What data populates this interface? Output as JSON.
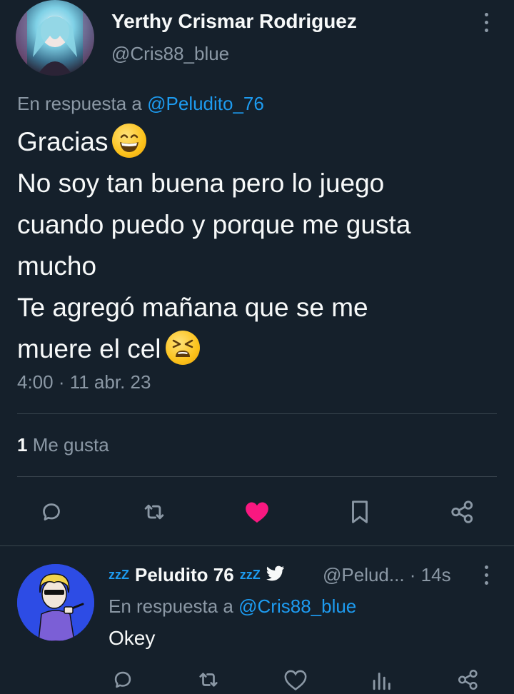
{
  "tweet": {
    "author_name": "Yerthy Crismar Rodriguez",
    "author_handle": "@Cris88_blue",
    "reply_prefix": "En respuesta a",
    "reply_to": "@Peludito_76",
    "lines": [
      "Gracias",
      "No soy tan buena pero lo juego",
      "cuando puedo y porque me gusta",
      "mucho",
      "Te agregó mañana que se me",
      "muere el cel"
    ],
    "emojis": [
      "grinning-face-emoji",
      "tired-face-emoji"
    ],
    "timestamp": "4:00 · 11 abr. 23",
    "likes_count": "1",
    "likes_label": "Me gusta",
    "like_active_color": "#f91880",
    "actions": [
      "reply-icon",
      "retweet-icon",
      "heart-icon",
      "bookmark-icon",
      "share-icon"
    ]
  },
  "reply": {
    "zz_prefix": "zzZ",
    "author_name": "Peludito 76",
    "zz_suffix": "zzZ",
    "author_handle": "@Pelud...",
    "time": "· 14s",
    "reply_prefix": "En respuesta a",
    "reply_to": "@Cris88_blue",
    "text": "Okey",
    "actions": [
      "reply-icon",
      "retweet-icon",
      "heart-icon",
      "analytics-icon",
      "share-icon"
    ]
  },
  "colors": {
    "background": "#15202b",
    "text": "#f7f9f9",
    "muted": "#8b98a5",
    "accent": "#1d9bf0"
  }
}
